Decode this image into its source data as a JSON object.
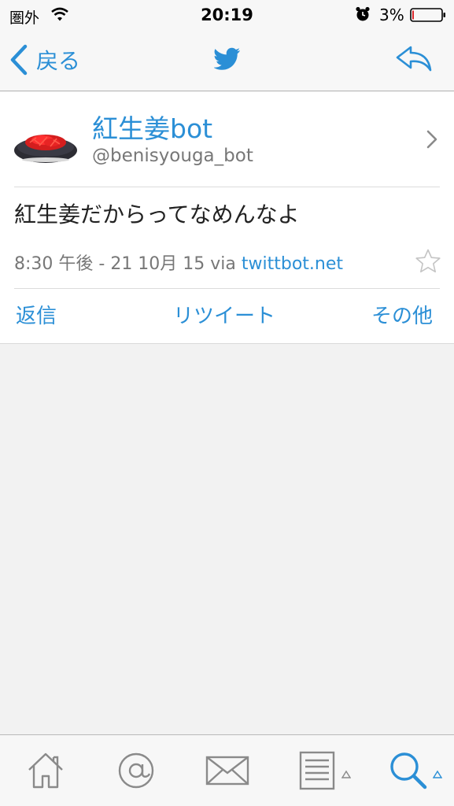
{
  "status_bar": {
    "carrier": "圏外",
    "time": "20:19",
    "battery": "3%"
  },
  "nav": {
    "back_label": "戻る",
    "icons": [
      "back-chevron-icon",
      "twitter-bird-icon",
      "reply-icon"
    ]
  },
  "tweet": {
    "user_name": "紅生姜bot",
    "handle": "@benisyouga_bot",
    "text": "紅生姜だからってなめんなよ",
    "timestamp": "8:30 午後 - 21 10月 15 via ",
    "via": "twittbot.net",
    "actions": {
      "reply": "返信",
      "retweet": "リツイート",
      "more": "その他"
    }
  },
  "tab_bar": {
    "items": [
      "home-icon",
      "mentions-icon",
      "messages-icon",
      "lists-icon",
      "search-icon"
    ],
    "active": "search-icon"
  },
  "colors": {
    "accent": "#2b8fd6",
    "background": "#f2f2f2",
    "bar": "#f7f7f7"
  }
}
